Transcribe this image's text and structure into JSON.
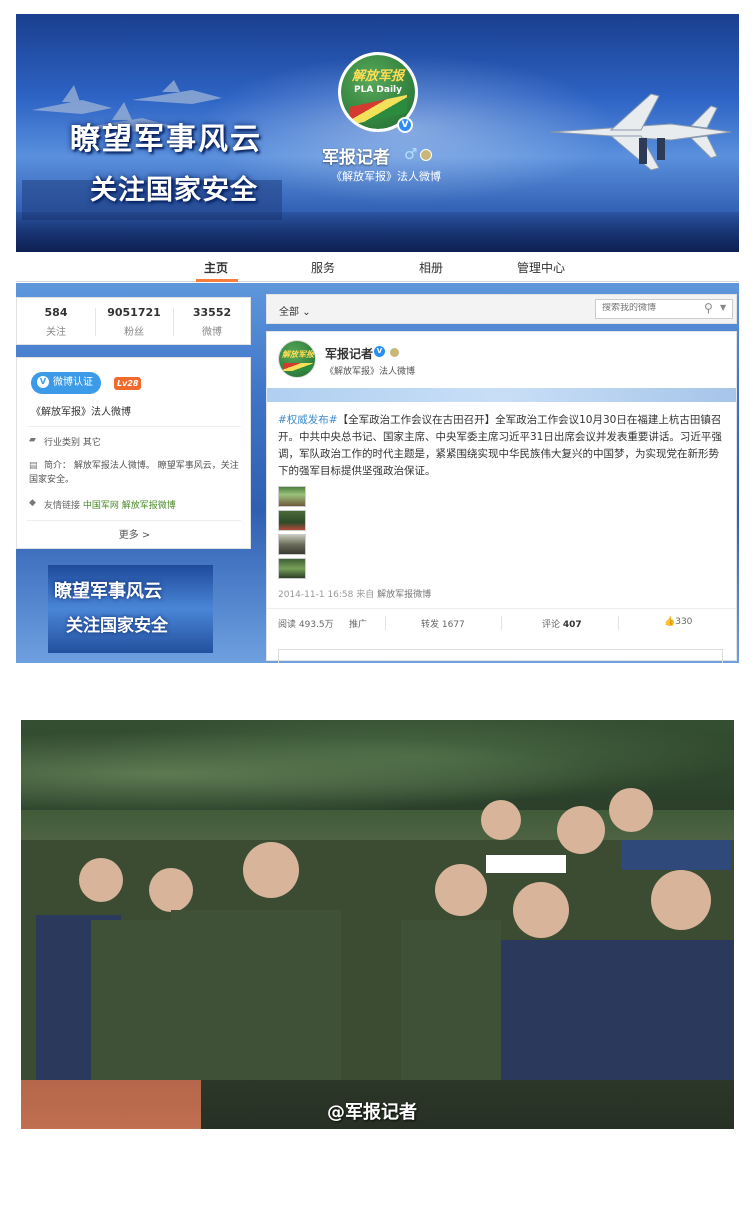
{
  "banner": {
    "slogan_line1": "瞭望军事风云",
    "slogan_line2": "关注国家安全",
    "logo_text": "解放军报",
    "logo_en": "PLA Daily",
    "profile_name": "军报记者",
    "profile_desc": "《解放军报》法人微博",
    "gender_icon": "male-icon"
  },
  "tabs": [
    "主页",
    "服务",
    "相册",
    "管理中心"
  ],
  "stats": [
    {
      "value": "584",
      "label": "关注"
    },
    {
      "value": "9051721",
      "label": "粉丝"
    },
    {
      "value": "33552",
      "label": "微博"
    }
  ],
  "info": {
    "verify_label": "微博认证",
    "level": "Lv28",
    "verify_text": "《解放军报》法人微博",
    "industry": "行业类别 其它",
    "intro": "简介：  解放军报法人微博。 瞭望军事风云，关注国家安全。",
    "links_label": "友情链接",
    "links": [
      "中国军网",
      "解放军报微博"
    ],
    "more": "更多 >"
  },
  "filter": {
    "all": "全部",
    "search_placeholder": "搜索我的微博"
  },
  "feed": {
    "name": "军报记者",
    "sub": "《解放军报》法人微博",
    "post": {
      "tag": "#权威发布#",
      "text": "【全军政治工作会议在古田召开】全军政治工作会议10月30日在福建上杭古田镇召开。中共中央总书记、国家主席、中央军委主席习近平31日出席会议并发表重要讲话。习近平强调，军队政治工作的时代主题是，紧紧围绕实现中华民族伟大复兴的中国梦，为实现党在新形势下的强军目标提供坚强政治保证。",
      "time": "2014-11-1 16:58",
      "source_prefix": "来自",
      "source": "解放军报微博"
    },
    "actions": {
      "read": "阅读 493.5万",
      "promote": "推广",
      "forward": "转发 1677",
      "comment_label": "评论",
      "comment_count": "407",
      "like": "330"
    }
  },
  "photo": {
    "watermark": "@军报记者"
  }
}
